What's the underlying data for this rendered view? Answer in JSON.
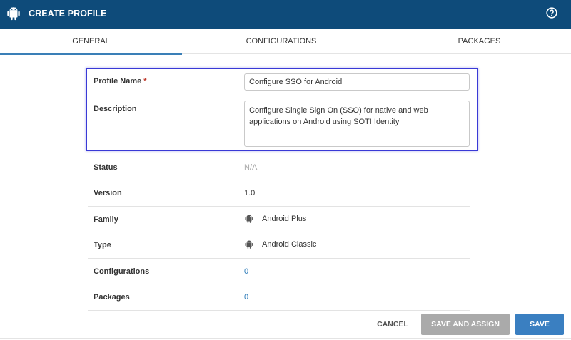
{
  "header": {
    "title": "CREATE PROFILE",
    "logo_icon": "android-icon",
    "help_icon": "help-circle-icon",
    "bg_color": "#0e4b7a"
  },
  "tabs": [
    {
      "label": "GENERAL",
      "active": true
    },
    {
      "label": "CONFIGURATIONS",
      "active": false
    },
    {
      "label": "PACKAGES",
      "active": false
    }
  ],
  "form": {
    "profile_name": {
      "label": "Profile Name",
      "required_mark": "*",
      "value": "Configure SSO for Android"
    },
    "description": {
      "label": "Description",
      "value": "Configure Single Sign On (SSO) for native and web applications on Android using SOTI Identity"
    },
    "status": {
      "label": "Status",
      "value": "N/A"
    },
    "version": {
      "label": "Version",
      "value": "1.0"
    },
    "family": {
      "label": "Family",
      "value": "Android Plus",
      "icon": "android-icon"
    },
    "type": {
      "label": "Type",
      "value": "Android Classic",
      "icon": "android-icon"
    },
    "configurations": {
      "label": "Configurations",
      "value": "0"
    },
    "packages": {
      "label": "Packages",
      "value": "0"
    }
  },
  "buttons": {
    "cancel": "CANCEL",
    "save_and_assign": "SAVE AND ASSIGN",
    "save": "SAVE"
  }
}
